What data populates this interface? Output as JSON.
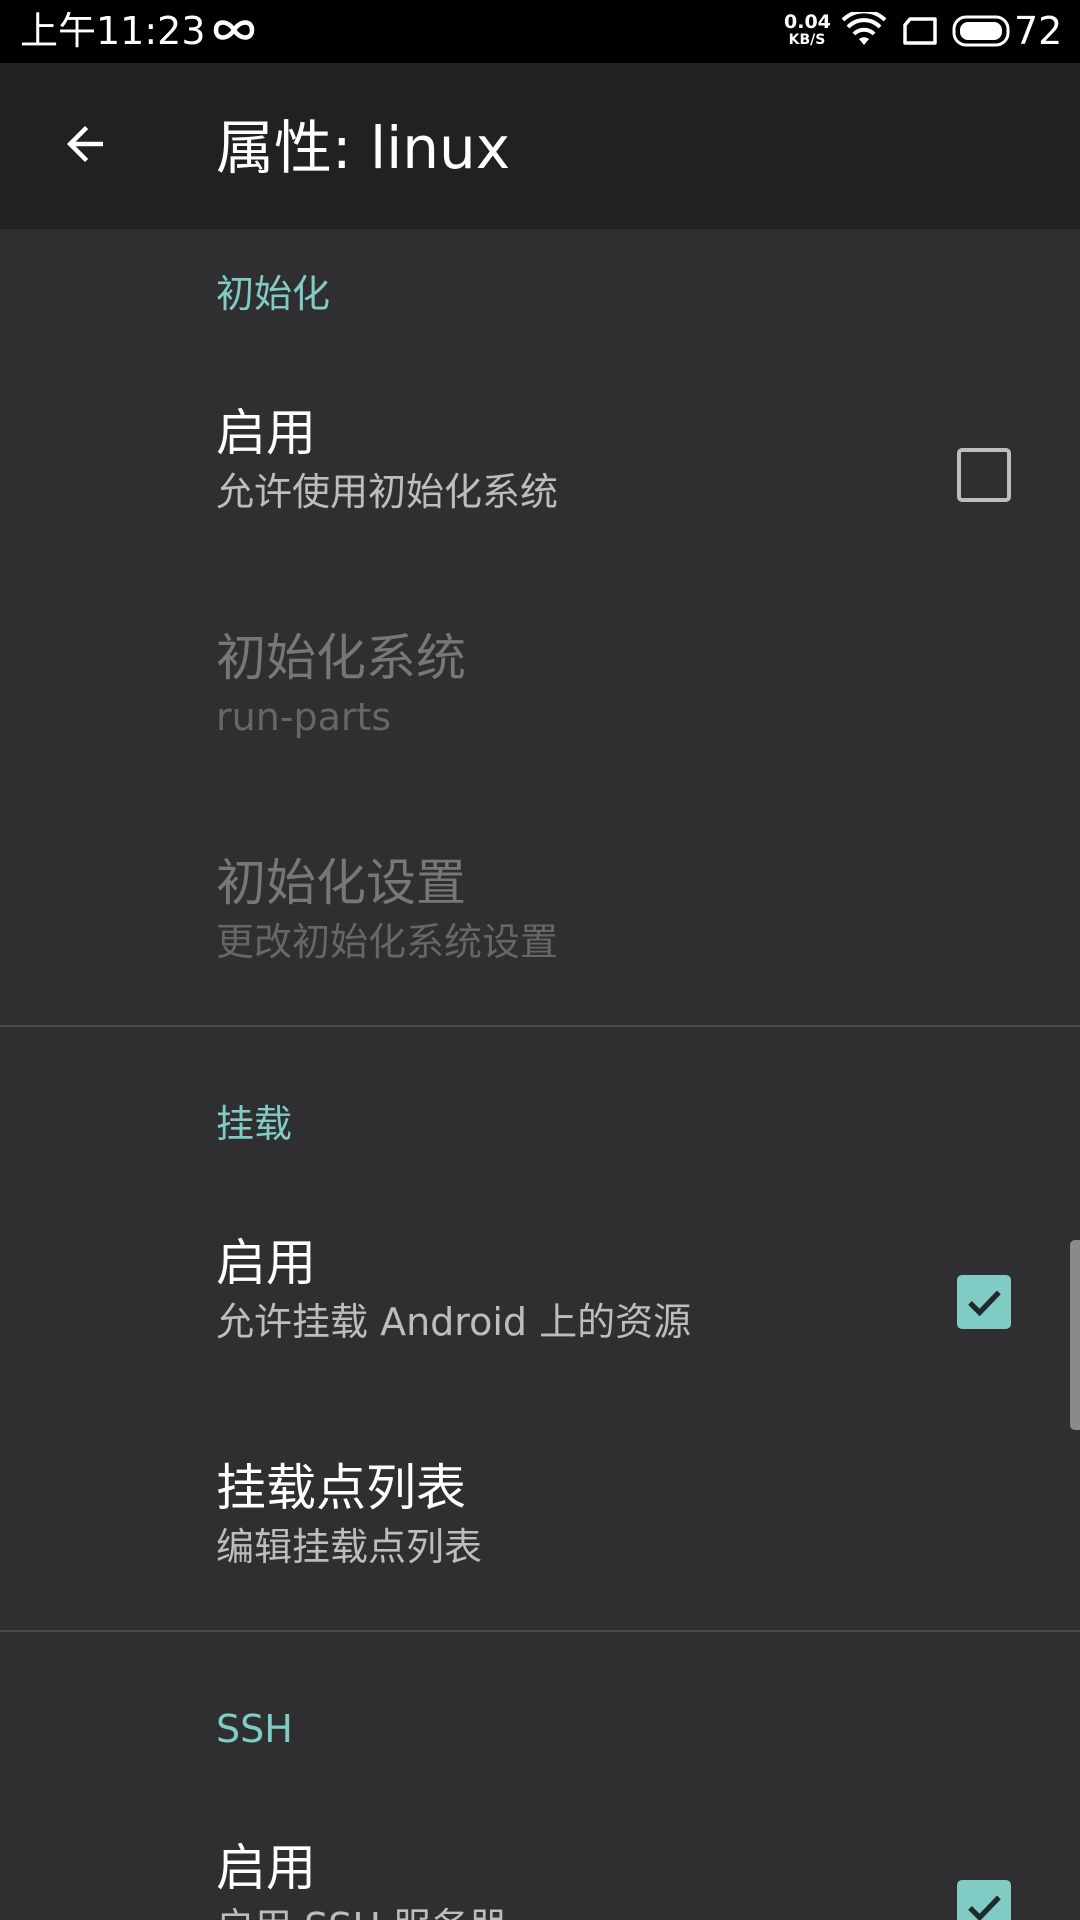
{
  "status_bar": {
    "time": "上午11:23",
    "net_speed": "0.04",
    "net_unit": "KB/S",
    "battery": "72",
    "icons": [
      "infinity-icon",
      "wifi-icon",
      "sim-card-icon",
      "battery-icon"
    ]
  },
  "toolbar": {
    "back_icon": "arrow-back-icon",
    "title": "属性: linux"
  },
  "sections": [
    {
      "header": "初始化",
      "items": [
        {
          "title": "启用",
          "summary": "允许使用初始化系统",
          "control": "checkbox",
          "checked": false,
          "enabled": true
        },
        {
          "title": "初始化系统",
          "summary": "run-parts",
          "enabled": false
        },
        {
          "title": "初始化设置",
          "summary": "更改初始化系统设置",
          "enabled": false
        }
      ]
    },
    {
      "header": "挂载",
      "items": [
        {
          "title": "启用",
          "summary": "允许挂载 Android 上的资源",
          "control": "checkbox",
          "checked": true,
          "enabled": true
        },
        {
          "title": "挂载点列表",
          "summary": "编辑挂载点列表",
          "enabled": true
        }
      ]
    },
    {
      "header": "SSH",
      "items": [
        {
          "title": "启用",
          "summary": "启用 SSH 服务器",
          "control": "checkbox",
          "checked": true,
          "enabled": true
        }
      ]
    }
  ],
  "colors": {
    "accent": "#80cbc4",
    "background": "#2f2f31",
    "toolbar": "#212121",
    "status_bar": "#000000"
  }
}
